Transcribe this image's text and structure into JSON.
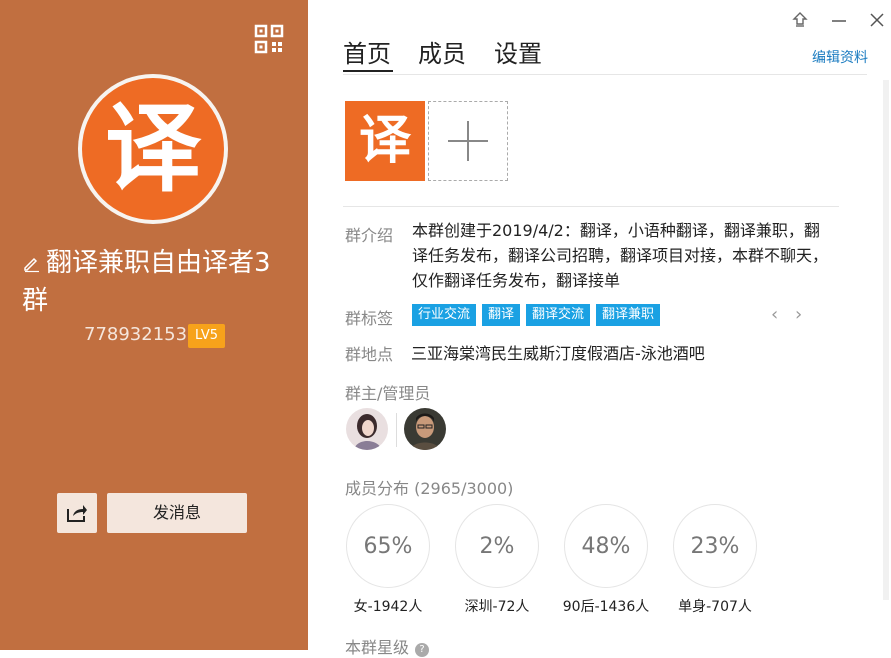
{
  "left": {
    "avatar_char": "译",
    "group_name": "翻译兼职自由译者3群",
    "group_id": "778932153",
    "level": "LV5",
    "send_message": "发消息"
  },
  "window": {
    "pin_icon": "pin-icon",
    "min_icon": "minimize-icon",
    "close_icon": "close-icon"
  },
  "tabs": [
    {
      "label": "首页",
      "active": true
    },
    {
      "label": "成员",
      "active": false
    },
    {
      "label": "设置",
      "active": false
    }
  ],
  "edit_profile": "编辑资料",
  "thumb_char": "译",
  "info": {
    "intro_label": "群介绍",
    "intro_text": "本群创建于2019/4/2：翻译，小语种翻译，翻译兼职，翻译任务发布，翻译公司招聘，翻译项目对接，本群不聊天，仅作翻译任务发布，翻译接单",
    "tags_label": "群标签",
    "tags": [
      "行业交流",
      "翻译",
      "翻译交流",
      "翻译兼职"
    ],
    "location_label": "群地点",
    "location": "三亚海棠湾民生威斯汀度假酒店-泳池酒吧"
  },
  "admins_title": "群主/管理员",
  "distribution": {
    "title": "成员分布",
    "count": "(2965/3000)",
    "items": [
      {
        "value": "65%",
        "label": "女-1942人"
      },
      {
        "value": "2%",
        "label": "深圳-72人"
      },
      {
        "value": "48%",
        "label": "90后-1436人"
      },
      {
        "value": "23%",
        "label": "单身-707人"
      }
    ]
  },
  "star_title": "本群星级",
  "colors": {
    "left_bg": "#c16f40",
    "accent_orange": "#ee6b24",
    "tag_blue": "#1aa1e3",
    "level_badge": "#f7a21b",
    "link": "#1a7bc0"
  }
}
